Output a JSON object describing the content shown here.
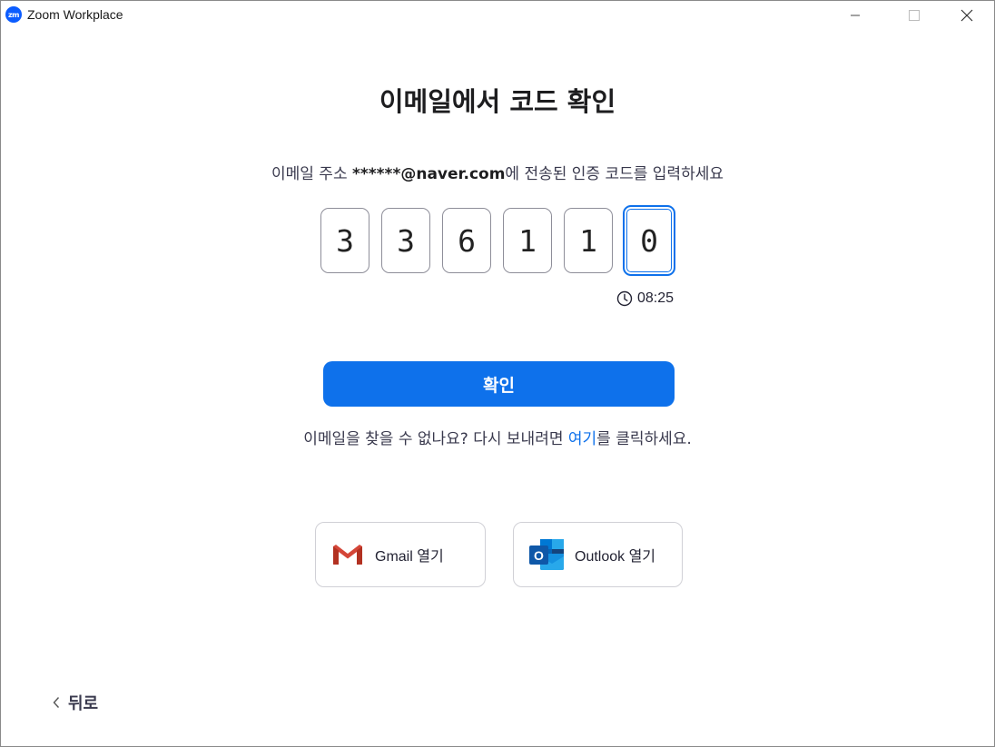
{
  "window": {
    "title": "Zoom Workplace",
    "logo_text": "zm",
    "controls": [
      "minimize-icon",
      "maximize-icon",
      "close-icon"
    ]
  },
  "heading": "이메일에서 코드 확인",
  "instruction": {
    "prefix": "이메일 주소 ",
    "email": "******@naver.com",
    "suffix": "에 전송된 인증 코드를 입력하세요"
  },
  "code_digits": [
    "3",
    "3",
    "6",
    "1",
    "1",
    "0"
  ],
  "active_digit_index": 5,
  "timer": {
    "icon": "clock-icon",
    "value": "08:25"
  },
  "confirm_button": "확인",
  "resend": {
    "prefix": "이메일을 찾을 수 없나요? 다시 보내려면 ",
    "link": "여기",
    "suffix": "를 클릭하세요."
  },
  "mail_buttons": {
    "gmail": {
      "label": "Gmail 열기",
      "icon": "gmail-icon"
    },
    "outlook": {
      "label": "Outlook 열기",
      "icon": "outlook-icon"
    }
  },
  "back": {
    "label": "뒤로",
    "icon": "chevron-left-icon"
  },
  "colors": {
    "accent": "#0e71eb",
    "zoom_blue": "#0b5cff"
  }
}
